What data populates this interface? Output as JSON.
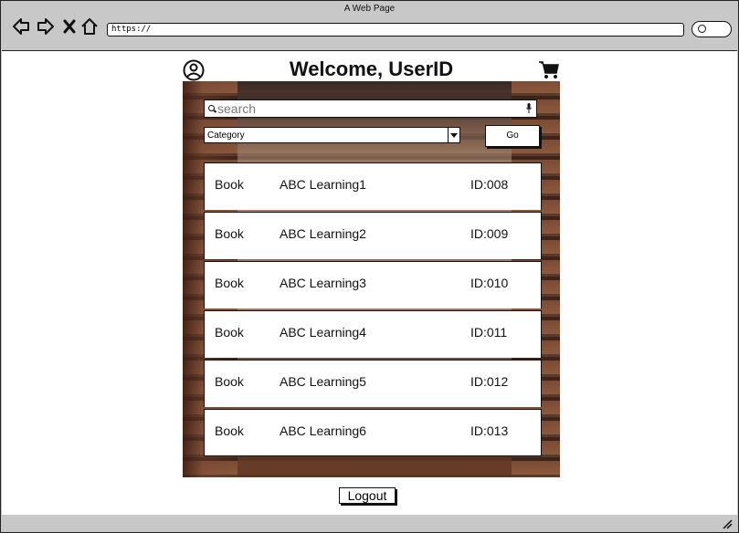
{
  "window": {
    "title": "A Web Page"
  },
  "browser": {
    "url": "https://",
    "nav_icons": [
      "back-arrow-icon",
      "forward-arrow-icon",
      "close-icon",
      "home-icon"
    ]
  },
  "header": {
    "title": "Welcome, UserID",
    "icons": [
      "user-profile-icon",
      "shopping-cart-icon"
    ]
  },
  "search": {
    "placeholder": "search"
  },
  "filter": {
    "category_selected": "Category",
    "go_label": "Go"
  },
  "items": [
    {
      "type": "Book",
      "name": "ABC Learning1",
      "id": "ID:008"
    },
    {
      "type": "Book",
      "name": "ABC Learning2",
      "id": "ID:009"
    },
    {
      "type": "Book",
      "name": "ABC Learning3",
      "id": "ID:010"
    },
    {
      "type": "Book",
      "name": "ABC Learning4",
      "id": "ID:011"
    },
    {
      "type": "Book",
      "name": "ABC Learning5",
      "id": "ID:012"
    },
    {
      "type": "Book",
      "name": "ABC Learning6",
      "id": "ID:013"
    }
  ],
  "footer": {
    "logout_label": "Logout"
  }
}
